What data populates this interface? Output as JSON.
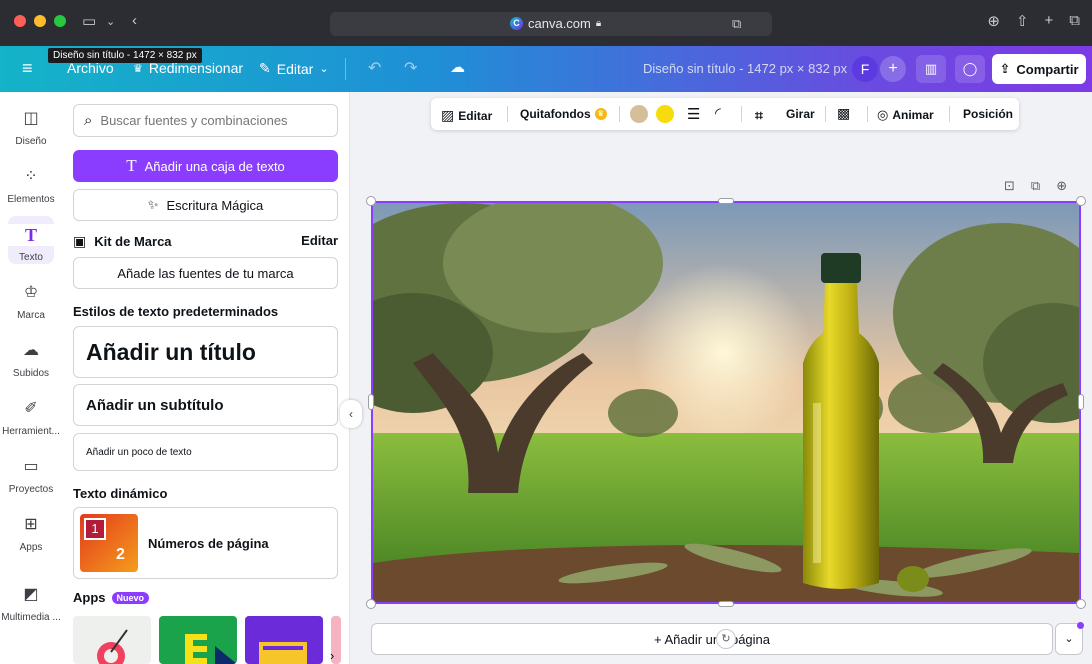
{
  "browser": {
    "url": "canva.com",
    "tooltip": "Diseño sin título - 1472 × 832 px"
  },
  "topbar": {
    "menu_icon": "hamburger-icon",
    "archivo": "Archivo",
    "redimensionar": "Redimensionar",
    "editar": "Editar",
    "doc_name": "Diseño sin título - 1472 px × 832 px",
    "avatar_initial": "F",
    "share_label": "Compartir"
  },
  "rail": {
    "items": [
      {
        "label": "Diseño",
        "icon": "layout-icon"
      },
      {
        "label": "Elementos",
        "icon": "shapes-icon"
      },
      {
        "label": "Texto",
        "icon": "text-icon"
      },
      {
        "label": "Marca",
        "icon": "brand-icon"
      },
      {
        "label": "Subidos",
        "icon": "upload-cloud-icon"
      },
      {
        "label": "Herramient...",
        "icon": "tools-icon"
      },
      {
        "label": "Proyectos",
        "icon": "folder-icon"
      },
      {
        "label": "Apps",
        "icon": "apps-icon"
      },
      {
        "label": "Multimedia ...",
        "icon": "media-icon"
      }
    ]
  },
  "panel": {
    "search_placeholder": "Buscar fuentes y combinaciones",
    "add_text_box": "Añadir una caja de texto",
    "magic_write": "Escritura Mágica",
    "brand_kit": "Kit de Marca",
    "brand_edit": "Editar",
    "add_brand_fonts": "Añade las fuentes de tu marca",
    "default_styles": "Estilos de texto predeterminados",
    "add_title": "Añadir un título",
    "add_subtitle": "Añadir un subtítulo",
    "add_body": "Añadir un poco de texto",
    "dynamic_text": "Texto dinámico",
    "page_numbers": "Números de página",
    "apps": "Apps",
    "new_badge": "Nuevo",
    "thumb_digit_1": "1",
    "thumb_digit_2": "2"
  },
  "context_toolbar": {
    "edit": "Editar",
    "bg_remover": "Quitafondos",
    "rotate": "Girar",
    "animate": "Animar",
    "position": "Posición",
    "swatch_1": "#d4bf99",
    "swatch_2": "#f7dc0d"
  },
  "canvas": {
    "add_page": "+ Añadir una página"
  },
  "colors": {
    "accent": "#8b3dff",
    "canva_teal": "#14b3c8"
  }
}
